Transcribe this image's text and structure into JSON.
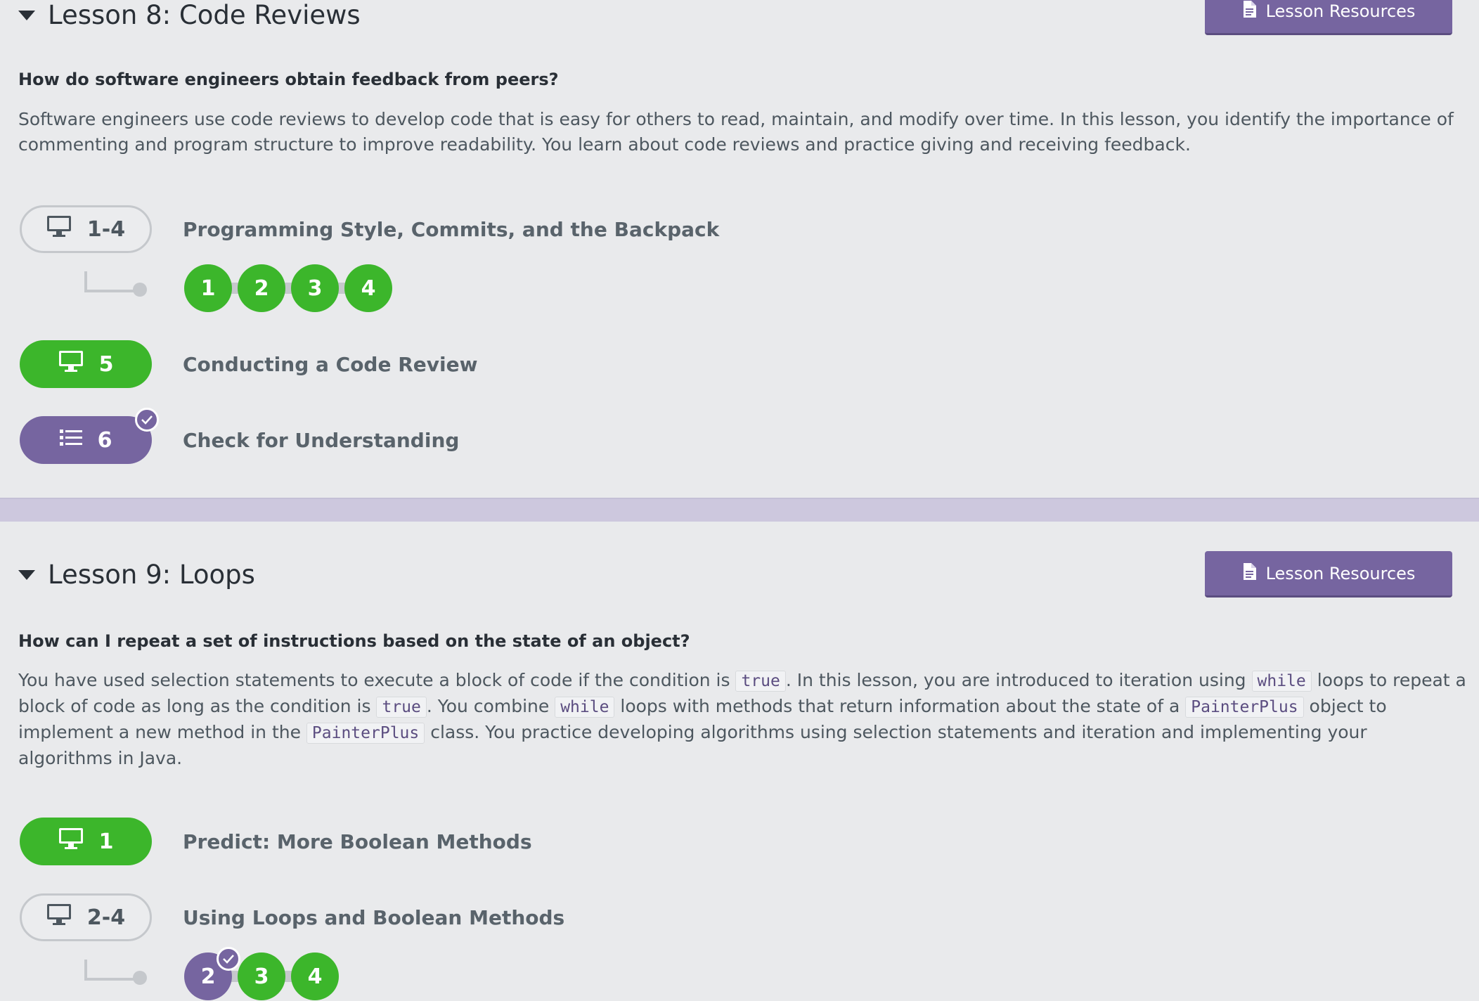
{
  "lesson8": {
    "title": "Lesson 8: Code Reviews",
    "resources_label": "Lesson Resources",
    "question": "How do software engineers obtain feedback from peers?",
    "overview": "Software engineers use code reviews to develop code that is easy for others to read, maintain, and modify over time. In this lesson, you identify the importance of commenting and program structure to improve readability. You learn about code reviews and practice giving and receiving feedback.",
    "activities": [
      {
        "number": "1-4",
        "label": "Programming Style, Commits, and the Backpack",
        "icon": "monitor-icon",
        "state": "outline"
      },
      {
        "number": "5",
        "label": "Conducting a Code Review",
        "icon": "monitor-icon",
        "state": "completed"
      },
      {
        "number": "6",
        "label": "Check for Understanding",
        "icon": "list-icon",
        "state": "submitted"
      }
    ],
    "levels": [
      "1",
      "2",
      "3",
      "4"
    ]
  },
  "lesson9": {
    "title": "Lesson 9: Loops",
    "resources_label": "Lesson Resources",
    "question": "How can I repeat a set of instructions based on the state of an object?",
    "overview": {
      "t1": "You have used selection statements to execute a block of code if the condition is ",
      "c1": "true",
      "t2": ". In this lesson, you are introduced to iteration using ",
      "c2": "while",
      "t3": " loops to repeat a block of code as long as the condition is ",
      "c3": "true",
      "t4": ". You combine ",
      "c4": "while",
      "t5": " loops with methods that return information about the state of a ",
      "c5": "PainterPlus",
      "t6": " object to implement a new method in the ",
      "c6": "PainterPlus",
      "t7": " class. You practice developing algorithms using selection statements and iteration and implementing your algorithms in Java."
    },
    "activities": [
      {
        "number": "1",
        "label": "Predict: More Boolean Methods",
        "icon": "monitor-icon",
        "state": "completed"
      },
      {
        "number": "2-4",
        "label": "Using Loops and Boolean Methods",
        "icon": "monitor-icon",
        "state": "outline"
      }
    ],
    "levels": [
      "2",
      "3",
      "4"
    ]
  },
  "colors": {
    "green": "#3cb62b",
    "purple": "#7665a0",
    "background": "#e9eaec",
    "divider": "#cdc8de"
  }
}
